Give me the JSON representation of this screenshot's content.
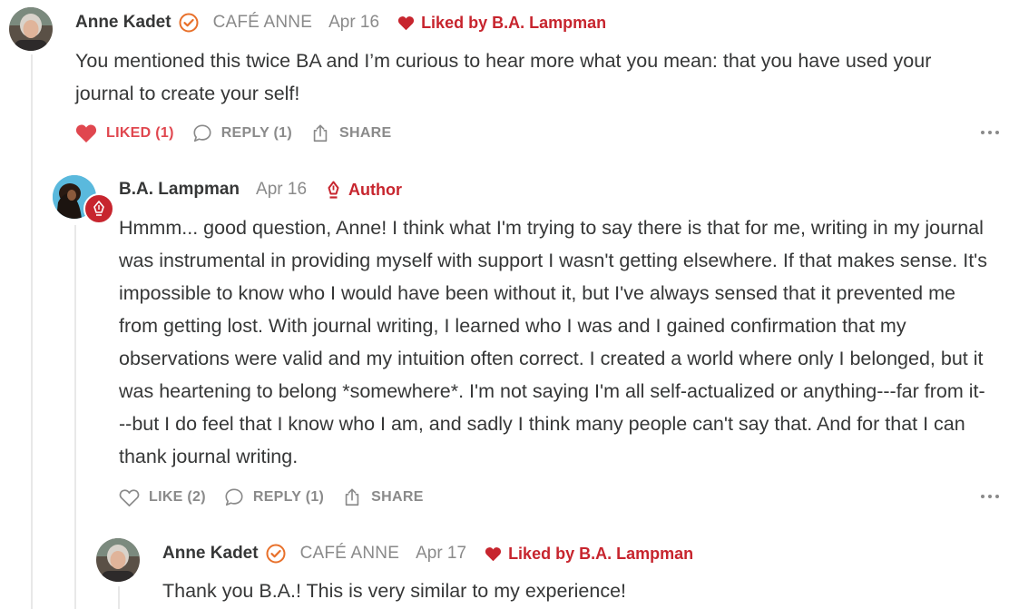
{
  "comments": [
    {
      "author": "Anne Kadet",
      "publication": "CAFÉ ANNE",
      "date": "Apr 16",
      "liked_by": "Liked by B.A. Lampman",
      "text": "You mentioned this twice BA and I’m curious to hear more what you mean: that you have used your journal to create your self!",
      "like_label": "LIKED (1)",
      "reply_label": "REPLY (1)",
      "share_label": "SHARE"
    },
    {
      "author": "B.A. Lampman",
      "date": "Apr 16",
      "badge": "Author",
      "text": "Hmmm... good question, Anne! I think what I'm trying to say there is that for me, writing in my journal was instrumental in providing myself with support I wasn't getting elsewhere. If that makes sense. It's impossible to know who I would have been without it, but I've always sensed that it prevented me from getting lost. With journal writing, I learned who I was and I gained confirmation that my observations were valid and my intuition often correct. I created a world where only I belonged, but it was heartening to belong *somewhere*. I'm not saying I'm all self-actualized or anything---far from it---but I do feel that I know who I am, and sadly I think many people can't say that. And for that I can thank journal writing.",
      "like_label": "LIKE (2)",
      "reply_label": "REPLY (1)",
      "share_label": "SHARE"
    },
    {
      "author": "Anne Kadet",
      "publication": "CAFÉ ANNE",
      "date": "Apr 17",
      "liked_by": "Liked by B.A. Lampman",
      "text": "Thank you B.A.! This is very similar to my experience!"
    }
  ],
  "colors": {
    "accent": "#c7252e",
    "liked": "#e0474f",
    "muted": "#8a8a8a",
    "text": "#363737",
    "verified": "#e8702a"
  },
  "icons": [
    "verified-check-icon",
    "heart-icon",
    "comment-bubble-icon",
    "share-icon",
    "more-dots-icon",
    "author-pen-icon"
  ]
}
